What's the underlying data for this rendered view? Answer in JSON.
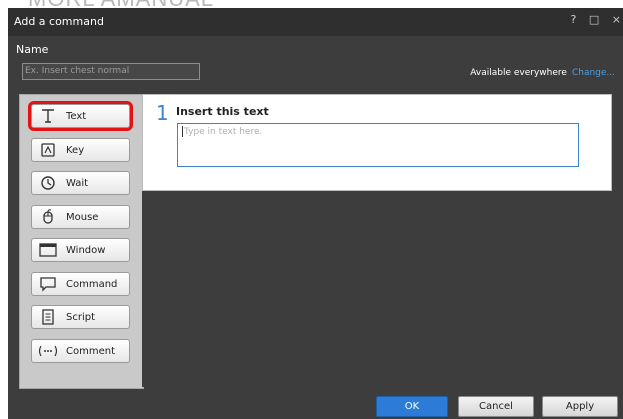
{
  "background_text": "MORL AMANUAL",
  "window": {
    "title": "Add a command",
    "help_glyph": "?",
    "maximize_glyph": "□",
    "close_glyph": "×"
  },
  "name": {
    "label": "Name",
    "placeholder": "Ex. Insert chest normal",
    "value": ""
  },
  "availability": {
    "text": "Available everywhere",
    "change_link": "Change..."
  },
  "commands": [
    {
      "label": "Text",
      "icon": "text-t-icon",
      "selected": true
    },
    {
      "label": "Key",
      "icon": "key-icon",
      "selected": false
    },
    {
      "label": "Wait",
      "icon": "clock-icon",
      "selected": false
    },
    {
      "label": "Mouse",
      "icon": "mouse-icon",
      "selected": false
    },
    {
      "label": "Window",
      "icon": "window-icon",
      "selected": false
    },
    {
      "label": "Command",
      "icon": "speech-bubble-icon",
      "selected": false
    },
    {
      "label": "Script",
      "icon": "script-icon",
      "selected": false
    },
    {
      "label": "Comment",
      "icon": "ellipsis-icon",
      "selected": false
    }
  ],
  "step": {
    "number": "1",
    "title": "Insert this text",
    "placeholder": "Type in text here."
  },
  "footer": {
    "ok": "OK",
    "cancel": "Cancel",
    "apply": "Apply"
  },
  "colors": {
    "accent": "#2c7bd6",
    "selection_outline": "#e01414",
    "dialog_bg": "#3d3d3d",
    "link": "#4a9fe0"
  }
}
